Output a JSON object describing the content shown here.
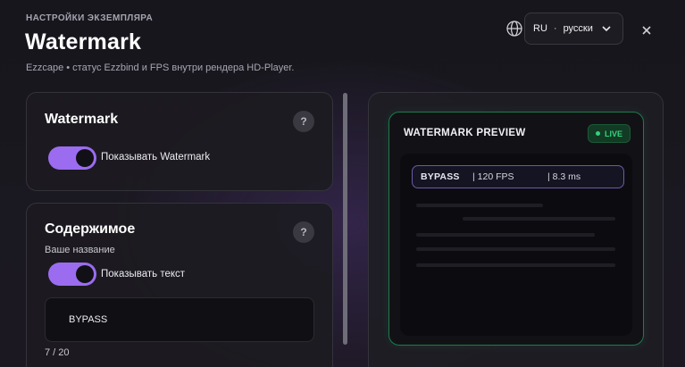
{
  "header": {
    "eyebrow": "НАСТРОЙКИ ЭКЗЕМПЛЯРА",
    "title": "Watermark",
    "subtitle": "Ezzcape • статус Ezzbind и FPS внутри рендера HD-Player."
  },
  "language": {
    "code": "RU",
    "separator": "·",
    "name": "русски"
  },
  "watermark_card": {
    "title": "Watermark",
    "help": "?",
    "toggle_label": "Показывать Watermark",
    "toggle_on": true
  },
  "content_card": {
    "title": "Содержимое",
    "help": "?",
    "name_label": "Ваше название",
    "toggle_label": "Показывать текст",
    "toggle_on": true,
    "input_value": "BYPASS",
    "counter": "7 / 20"
  },
  "preview": {
    "title": "WATERMARK PREVIEW",
    "live": "LIVE",
    "watermark": {
      "brand": "BYPASS",
      "fps": "| 120 FPS",
      "latency": "| 8.3 ms"
    }
  },
  "colors": {
    "accent": "#9b6cf0",
    "live_green": "#34d27a",
    "preview_border": "#1f7a4a"
  }
}
